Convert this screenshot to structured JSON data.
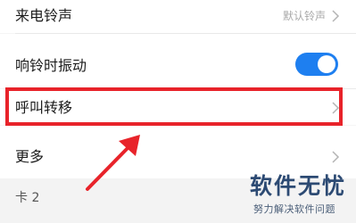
{
  "settings": {
    "ringtone": {
      "label": "来电铃声",
      "value": "默认铃声"
    },
    "vibrate": {
      "label": "响铃时振动",
      "enabled": true
    },
    "call_forwarding": {
      "label": "呼叫转移"
    },
    "more": {
      "label": "更多"
    }
  },
  "section": {
    "title": "卡 2"
  },
  "annotation": {
    "highlight_color": "#e8232a"
  },
  "watermark": {
    "title": "软件无忧",
    "subtitle": "努力解决软件问题"
  },
  "colors": {
    "toggle_on": "#1e7ff0",
    "value_text": "#a8a8a8",
    "watermark": "#2c4a73"
  }
}
